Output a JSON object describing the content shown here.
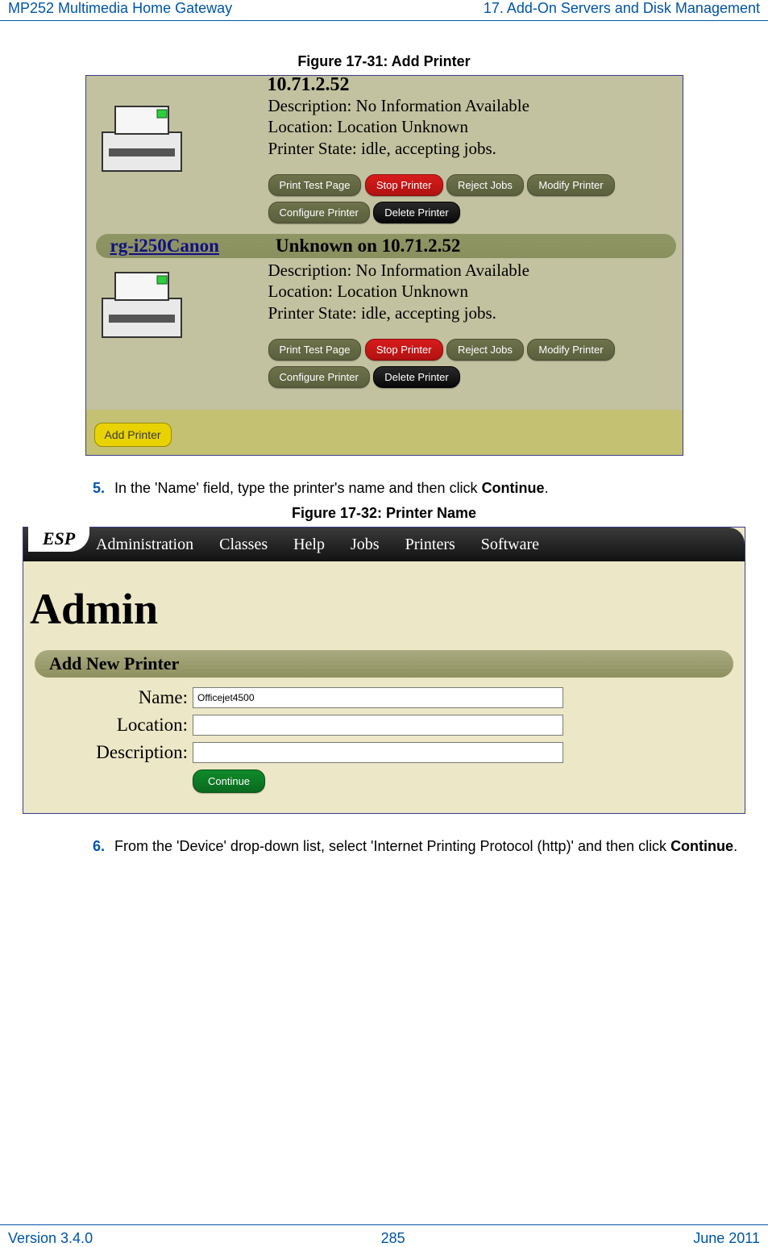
{
  "header": {
    "left": "MP252 Multimedia Home Gateway",
    "right": "17. Add-On Servers and Disk Management"
  },
  "fig1": {
    "caption": "Figure 17-31: Add Printer",
    "ip": "10.71.2.52",
    "desc": "Description: No Information Available",
    "loc": "Location: Location Unknown",
    "state": "Printer State: idle, accepting jobs.",
    "link": "rg-i250Canon",
    "unknown": "Unknown on 10.71.2.52",
    "buttons": {
      "test": "Print Test Page",
      "stop": "Stop Printer",
      "reject": "Reject Jobs",
      "modify": "Modify Printer",
      "config": "Configure Printer",
      "delete": "Delete Printer"
    },
    "add": "Add Printer"
  },
  "step5": {
    "num": "5.",
    "text_a": "In the 'Name' field, type the printer's name and then click ",
    "text_b": "Continue",
    "text_c": "."
  },
  "fig2": {
    "caption": "Figure 17-32: Printer Name",
    "tabs": [
      "Administration",
      "Classes",
      "Help",
      "Jobs",
      "Printers",
      "Software"
    ],
    "esp": "ESP",
    "title": "Admin",
    "bar": "Add New Printer",
    "labels": {
      "name": "Name:",
      "location": "Location:",
      "description": "Description:"
    },
    "name_value": "Officejet4500",
    "continue": "Continue"
  },
  "step6": {
    "num": "6.",
    "text_a": "From the 'Device' drop-down list, select 'Internet Printing Protocol (http)' and then click ",
    "text_b": "Continue",
    "text_c": "."
  },
  "footer": {
    "left": "Version 3.4.0",
    "center": "285",
    "right": "June 2011"
  }
}
